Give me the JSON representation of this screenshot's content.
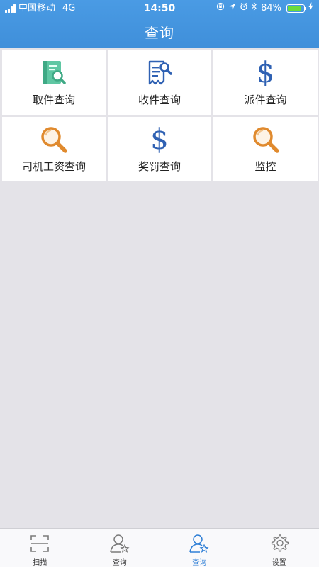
{
  "status_bar": {
    "carrier": "中国移动",
    "network": "4G",
    "time": "14:50",
    "battery": "84%",
    "battery_level": 0.84,
    "icons": [
      "lock-rotation-icon",
      "location-icon",
      "alarm-icon",
      "bluetooth-icon",
      "charging-icon"
    ]
  },
  "nav": {
    "title": "查询"
  },
  "menu": [
    {
      "label": "取件查询",
      "icon": "document-search-icon"
    },
    {
      "label": "收件查询",
      "icon": "receipt-search-icon"
    },
    {
      "label": "派件查询",
      "icon": "dollar-icon"
    },
    {
      "label": "司机工资查询",
      "icon": "magnifier-icon"
    },
    {
      "label": "奖罚查询",
      "icon": "dollar-icon"
    },
    {
      "label": "监控",
      "icon": "magnifier-icon"
    }
  ],
  "tabbar": {
    "tabs": [
      {
        "label": "扫描",
        "icon": "scan-icon",
        "active": false
      },
      {
        "label": "查询",
        "icon": "user-star-icon",
        "active": false
      },
      {
        "label": "查询",
        "icon": "user-star-icon",
        "active": true
      },
      {
        "label": "设置",
        "icon": "gear-icon",
        "active": false
      }
    ]
  },
  "colors": {
    "header": "#3f8fda",
    "accent": "#2f7fd6",
    "dollar": "#2f61b3",
    "magnifier": "#e08a2e",
    "doc_green": "#55c09a"
  }
}
